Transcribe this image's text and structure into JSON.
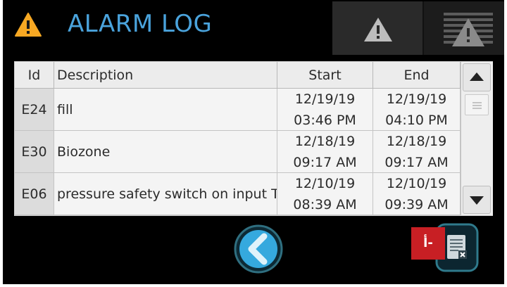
{
  "header": {
    "title": "ALARM LOG",
    "icon": "warning-icon",
    "tabs": [
      {
        "icon": "warning-icon",
        "state": "active"
      },
      {
        "icon": "alarm-history-icon",
        "state": "inactive"
      }
    ]
  },
  "table": {
    "columns": [
      "Id",
      "Description",
      "Start",
      "End"
    ],
    "rows": [
      {
        "id": "E24",
        "description": "fill",
        "start_date": "12/19/19",
        "start_time": "03:46 PM",
        "end_date": "12/19/19",
        "end_time": "04:10 PM"
      },
      {
        "id": "E30",
        "description": "Biozone",
        "start_date": "12/18/19",
        "start_time": "09:17 AM",
        "end_date": "12/18/19",
        "end_time": "09:17 AM"
      },
      {
        "id": "E06",
        "description": "pressure safety switch on input T",
        "start_date": "12/10/19",
        "start_time": "08:39 AM",
        "end_date": "12/10/19",
        "end_time": "09:39 AM"
      }
    ]
  },
  "controls": {
    "back_icon": "chevron-left-icon",
    "clear_icon": "clear-log-icon"
  },
  "annotation": {
    "label": "أ-"
  },
  "colors": {
    "accent": "#4aa3dc",
    "warning": "#f7a823",
    "badge": "#c81f24",
    "background": "#000000"
  }
}
